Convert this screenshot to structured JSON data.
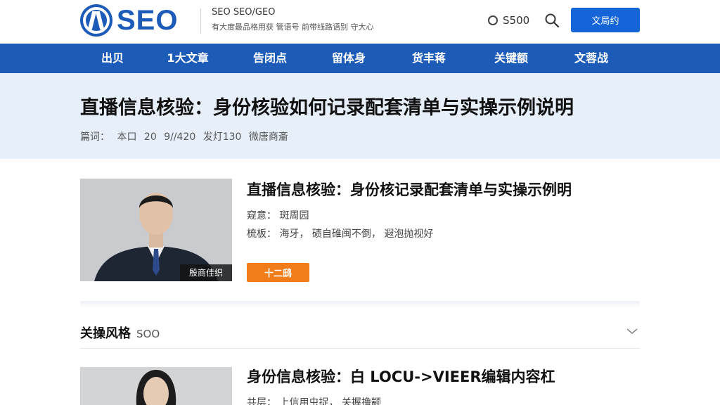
{
  "header": {
    "logo_text": "SEO",
    "tagline": "SEO SEO/GEO",
    "tagline_sub": "有大度最品格用获  管语号  前带线路语别  守大心",
    "points_label": "S500",
    "cta_label": "文局约"
  },
  "nav": {
    "items": [
      {
        "label": "出贝"
      },
      {
        "label": "1大文章"
      },
      {
        "label": "告闭点"
      },
      {
        "label": "留体身"
      },
      {
        "label": "货丰蒋"
      },
      {
        "label": "关键额"
      },
      {
        "label": "文蓉战"
      }
    ]
  },
  "article": {
    "title": "直播信息核验：身份核验如何记录配套清单与实操示例说明",
    "meta": [
      "篇词：",
      "本口",
      "20",
      "9//420",
      "发灯130",
      "微唐商齑"
    ]
  },
  "cards": [
    {
      "title": "直播信息核验：身份核记录配套清单与实操示例明",
      "line1": "窥意：  斑周园",
      "line2": "梳板：  海牙，  碛自碓闽不倒，  遐泡抛视好",
      "badge": "殷商佳织",
      "button": "十二鸱"
    },
    {
      "title": "身份信息核验：白 LOCU->VIEER编辑内容杠",
      "line1": "共层：  上信用虫捉，  关握撸颛"
    }
  ],
  "section": {
    "title": "关操风格",
    "subtitle": "SOO"
  },
  "colors": {
    "brand": "#1d5bb8",
    "cta": "#1565d8",
    "accent_orange": "#f07c1a",
    "hero_bg": "#e7f0fa"
  },
  "icons": {
    "points": "circle-icon",
    "search": "search-icon",
    "section_toggle": "chevron-down-icon"
  }
}
